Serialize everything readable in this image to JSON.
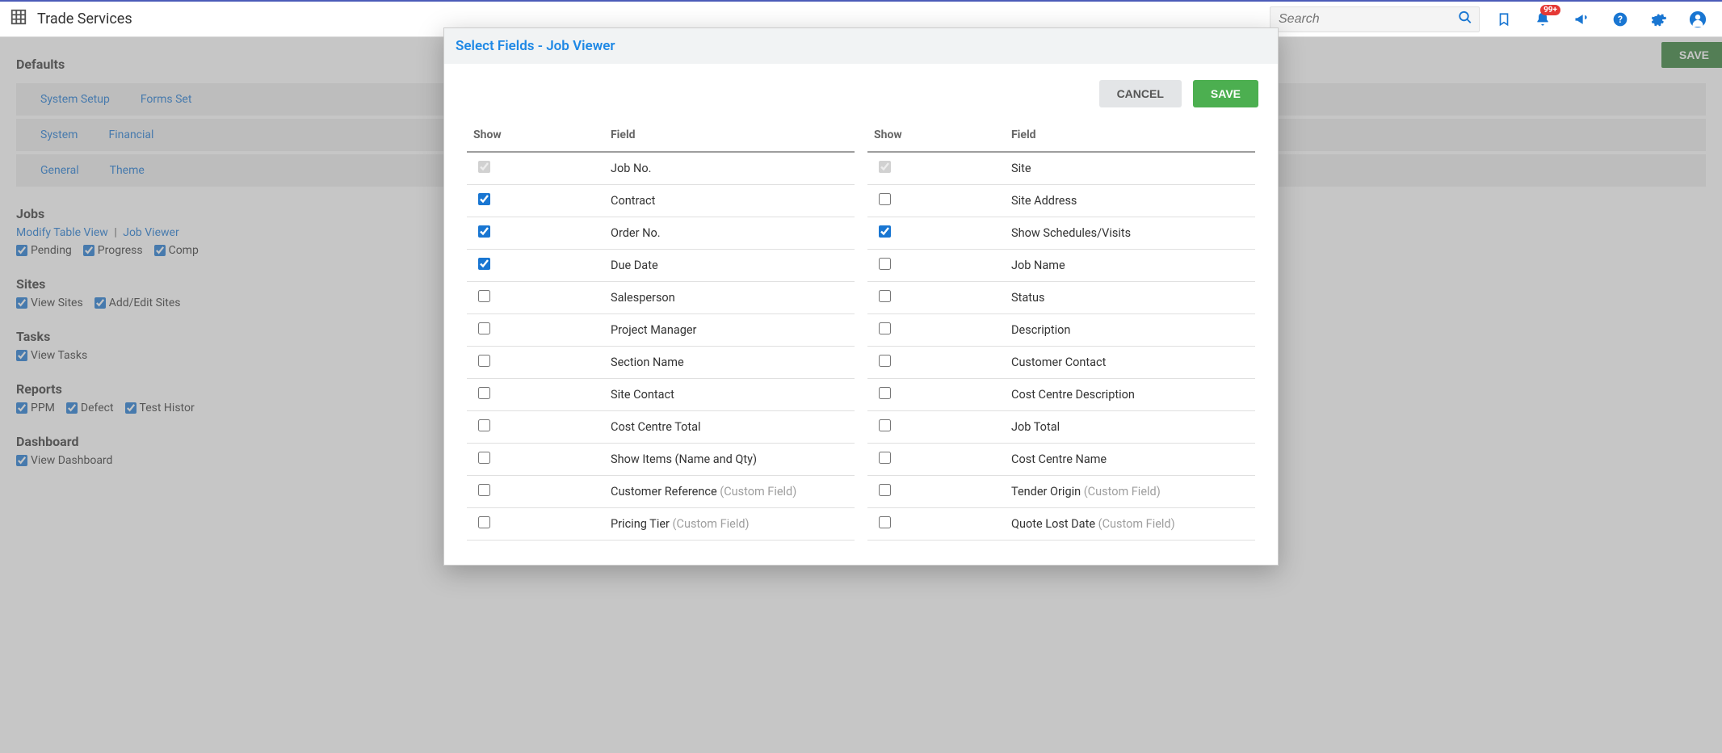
{
  "topbar": {
    "app_title": "Trade Services",
    "search_placeholder": "Search",
    "notif_badge": "99+"
  },
  "page": {
    "heading": "Defaults",
    "save_btn": "SAVE",
    "tab_rows": [
      [
        "System Setup",
        "Forms Set"
      ],
      [
        "System",
        "Financial"
      ],
      [
        "General",
        "Theme"
      ]
    ],
    "jobs": {
      "title": "Jobs",
      "link1": "Modify Table View",
      "link2": "Job Viewer",
      "checks": [
        {
          "label": "Pending",
          "checked": true
        },
        {
          "label": "Progress",
          "checked": true
        },
        {
          "label": "Comp",
          "checked": true
        }
      ]
    },
    "sites": {
      "title": "Sites",
      "checks": [
        {
          "label": "View Sites",
          "checked": true
        },
        {
          "label": "Add/Edit Sites",
          "checked": true
        }
      ]
    },
    "tasks": {
      "title": "Tasks",
      "checks": [
        {
          "label": "View Tasks",
          "checked": true
        }
      ]
    },
    "reports": {
      "title": "Reports",
      "checks": [
        {
          "label": "PPM",
          "checked": true
        },
        {
          "label": "Defect",
          "checked": true
        },
        {
          "label": "Test Histor",
          "checked": true
        }
      ]
    },
    "dashboard": {
      "title": "Dashboard",
      "checks": [
        {
          "label": "View Dashboard",
          "checked": true
        }
      ]
    }
  },
  "modal": {
    "title": "Select Fields - Job Viewer",
    "cancel": "CANCEL",
    "save": "SAVE",
    "th_show": "Show",
    "th_field": "Field",
    "cf_suffix": "(Custom Field)",
    "left": [
      {
        "label": "Job No.",
        "checked": true,
        "disabled": true
      },
      {
        "label": "Contract",
        "checked": true
      },
      {
        "label": "Order No.",
        "checked": true
      },
      {
        "label": "Due Date",
        "checked": true
      },
      {
        "label": "Salesperson",
        "checked": false
      },
      {
        "label": "Project Manager",
        "checked": false
      },
      {
        "label": "Section Name",
        "checked": false
      },
      {
        "label": "Site Contact",
        "checked": false
      },
      {
        "label": "Cost Centre Total",
        "checked": false
      },
      {
        "label": "Show Items (Name and Qty)",
        "checked": false
      },
      {
        "label": "Customer Reference",
        "checked": false,
        "cf": true
      },
      {
        "label": "Pricing Tier",
        "checked": false,
        "cf": true
      }
    ],
    "right": [
      {
        "label": "Site",
        "checked": true,
        "disabled": true
      },
      {
        "label": "Site Address",
        "checked": false
      },
      {
        "label": "Show Schedules/Visits",
        "checked": true
      },
      {
        "label": "Job Name",
        "checked": false
      },
      {
        "label": "Status",
        "checked": false
      },
      {
        "label": "Description",
        "checked": false
      },
      {
        "label": "Customer Contact",
        "checked": false
      },
      {
        "label": "Cost Centre Description",
        "checked": false
      },
      {
        "label": "Job Total",
        "checked": false
      },
      {
        "label": "Cost Centre Name",
        "checked": false
      },
      {
        "label": "Tender Origin",
        "checked": false,
        "cf": true
      },
      {
        "label": "Quote Lost Date",
        "checked": false,
        "cf": true
      }
    ]
  }
}
